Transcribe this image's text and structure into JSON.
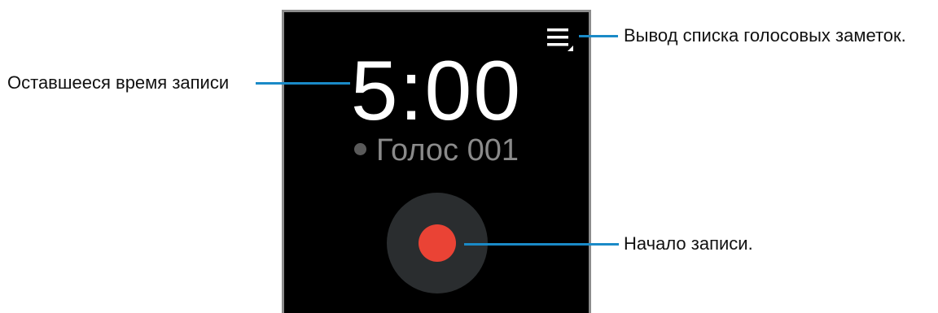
{
  "recorder": {
    "remaining_time": "5:00",
    "recording_name": "Голос 001",
    "menu_icon": "list-menu-icon",
    "record_button_icon": "record-icon",
    "colors": {
      "screen_bg": "#000000",
      "record_red": "#ea4335",
      "record_ring": "#2a2d2f",
      "callout_blue": "#1a8ac7"
    }
  },
  "callouts": {
    "remaining_time": "Оставшееся время записи",
    "list_notes": "Вывод списка голосовых заметок.",
    "start_recording": "Начало записи."
  }
}
